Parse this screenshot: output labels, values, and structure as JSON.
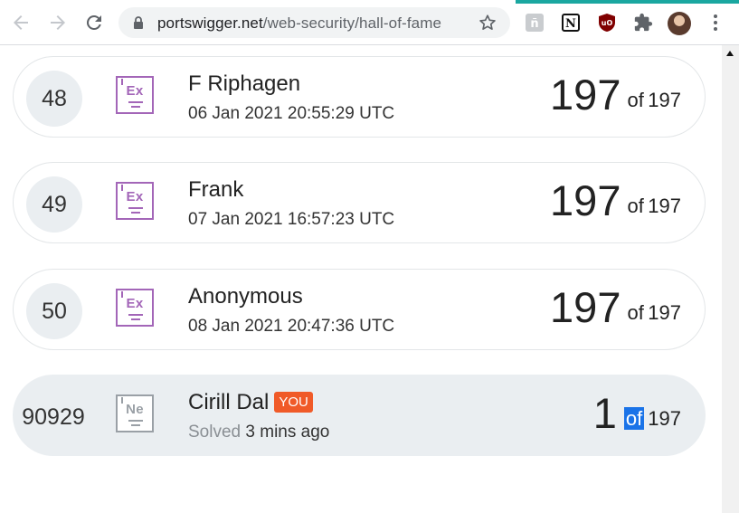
{
  "browser": {
    "url_host": "portswigger.net",
    "url_path": "/web-security/hall-of-fame"
  },
  "leaderboard": {
    "rows": [
      {
        "rank": "48",
        "badge": "Ex",
        "name": "F Riphagen",
        "date": "06 Jan 2021 20:55:29 UTC",
        "score": "197",
        "of_label": "of",
        "total": "197"
      },
      {
        "rank": "49",
        "badge": "Ex",
        "name": "Frank",
        "date": "07 Jan 2021 16:57:23 UTC",
        "score": "197",
        "of_label": "of",
        "total": "197"
      },
      {
        "rank": "50",
        "badge": "Ex",
        "name": "Anonymous",
        "date": "08 Jan 2021 20:47:36 UTC",
        "score": "197",
        "of_label": "of",
        "total": "197"
      }
    ],
    "current_user": {
      "rank": "90929",
      "badge": "Ne",
      "name": "Cirill Dal",
      "you_label": "YOU",
      "solved_label": "Solved",
      "solved_time": "3 mins ago",
      "score": "1",
      "of_label": "of",
      "total": "197"
    }
  },
  "colors": {
    "badge_expert": "#a366b8",
    "badge_newbie": "#9aa0a6",
    "you_badge": "#f05a28",
    "selection": "#1a73e8",
    "accent_bar": "#1aa7a0"
  },
  "icons": [
    "back-arrow-icon",
    "forward-arrow-icon",
    "reload-icon",
    "lock-icon",
    "star-icon",
    "extension-icon",
    "notion-icon",
    "ublock-icon",
    "puzzle-icon",
    "avatar",
    "kebab-menu-icon"
  ]
}
